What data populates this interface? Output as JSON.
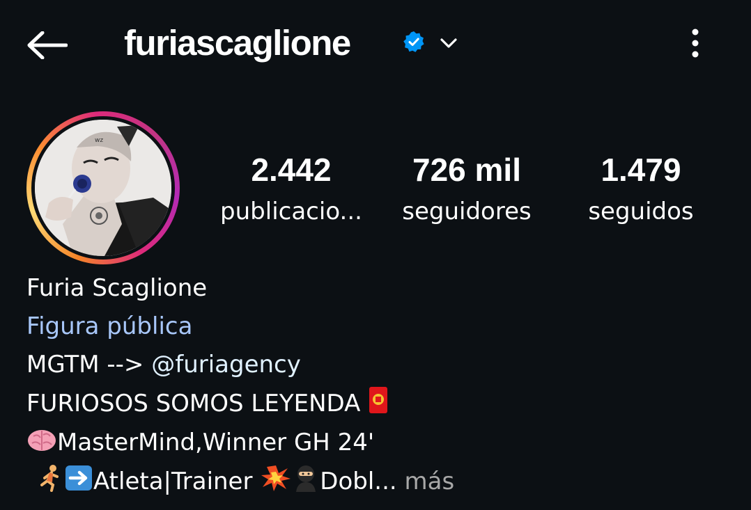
{
  "header": {
    "username": "furiascaglione",
    "icons": {
      "back": "back-arrow-icon",
      "verified": "verified-badge-icon",
      "dropdown": "chevron-down-icon",
      "more": "more-vertical-icon"
    },
    "verified_color": "#0095f6"
  },
  "profile": {
    "avatar": "profile-picture",
    "story_ring_colors": [
      "#f58529",
      "#dd2a7b",
      "#c13584"
    ]
  },
  "stats": [
    {
      "value": "2.442",
      "label": "publicacio..."
    },
    {
      "value": "726 mil",
      "label": "seguidores"
    },
    {
      "value": "1.479",
      "label": "seguidos"
    }
  ],
  "bio": {
    "name": "Furia Scaglione",
    "category": "Figura pública",
    "line1_prefix": "MGTM --> ",
    "line1_mention": "@furiagency",
    "line2": "FURIOSOS SOMOS LEYENDA",
    "line3": "MasterMind,Winner GH 24'",
    "line4_a": "Atleta|Trainer",
    "line4_b": "Dobl...",
    "more_label": "más",
    "emoji_names": [
      "red-envelope-emoji",
      "brain-emoji",
      "runner-emoji",
      "right-arrow-emoji",
      "collision-emoji",
      "ninja-emoji"
    ],
    "mention_color": "#e0f1ff",
    "category_color": "#a8c7fa"
  }
}
